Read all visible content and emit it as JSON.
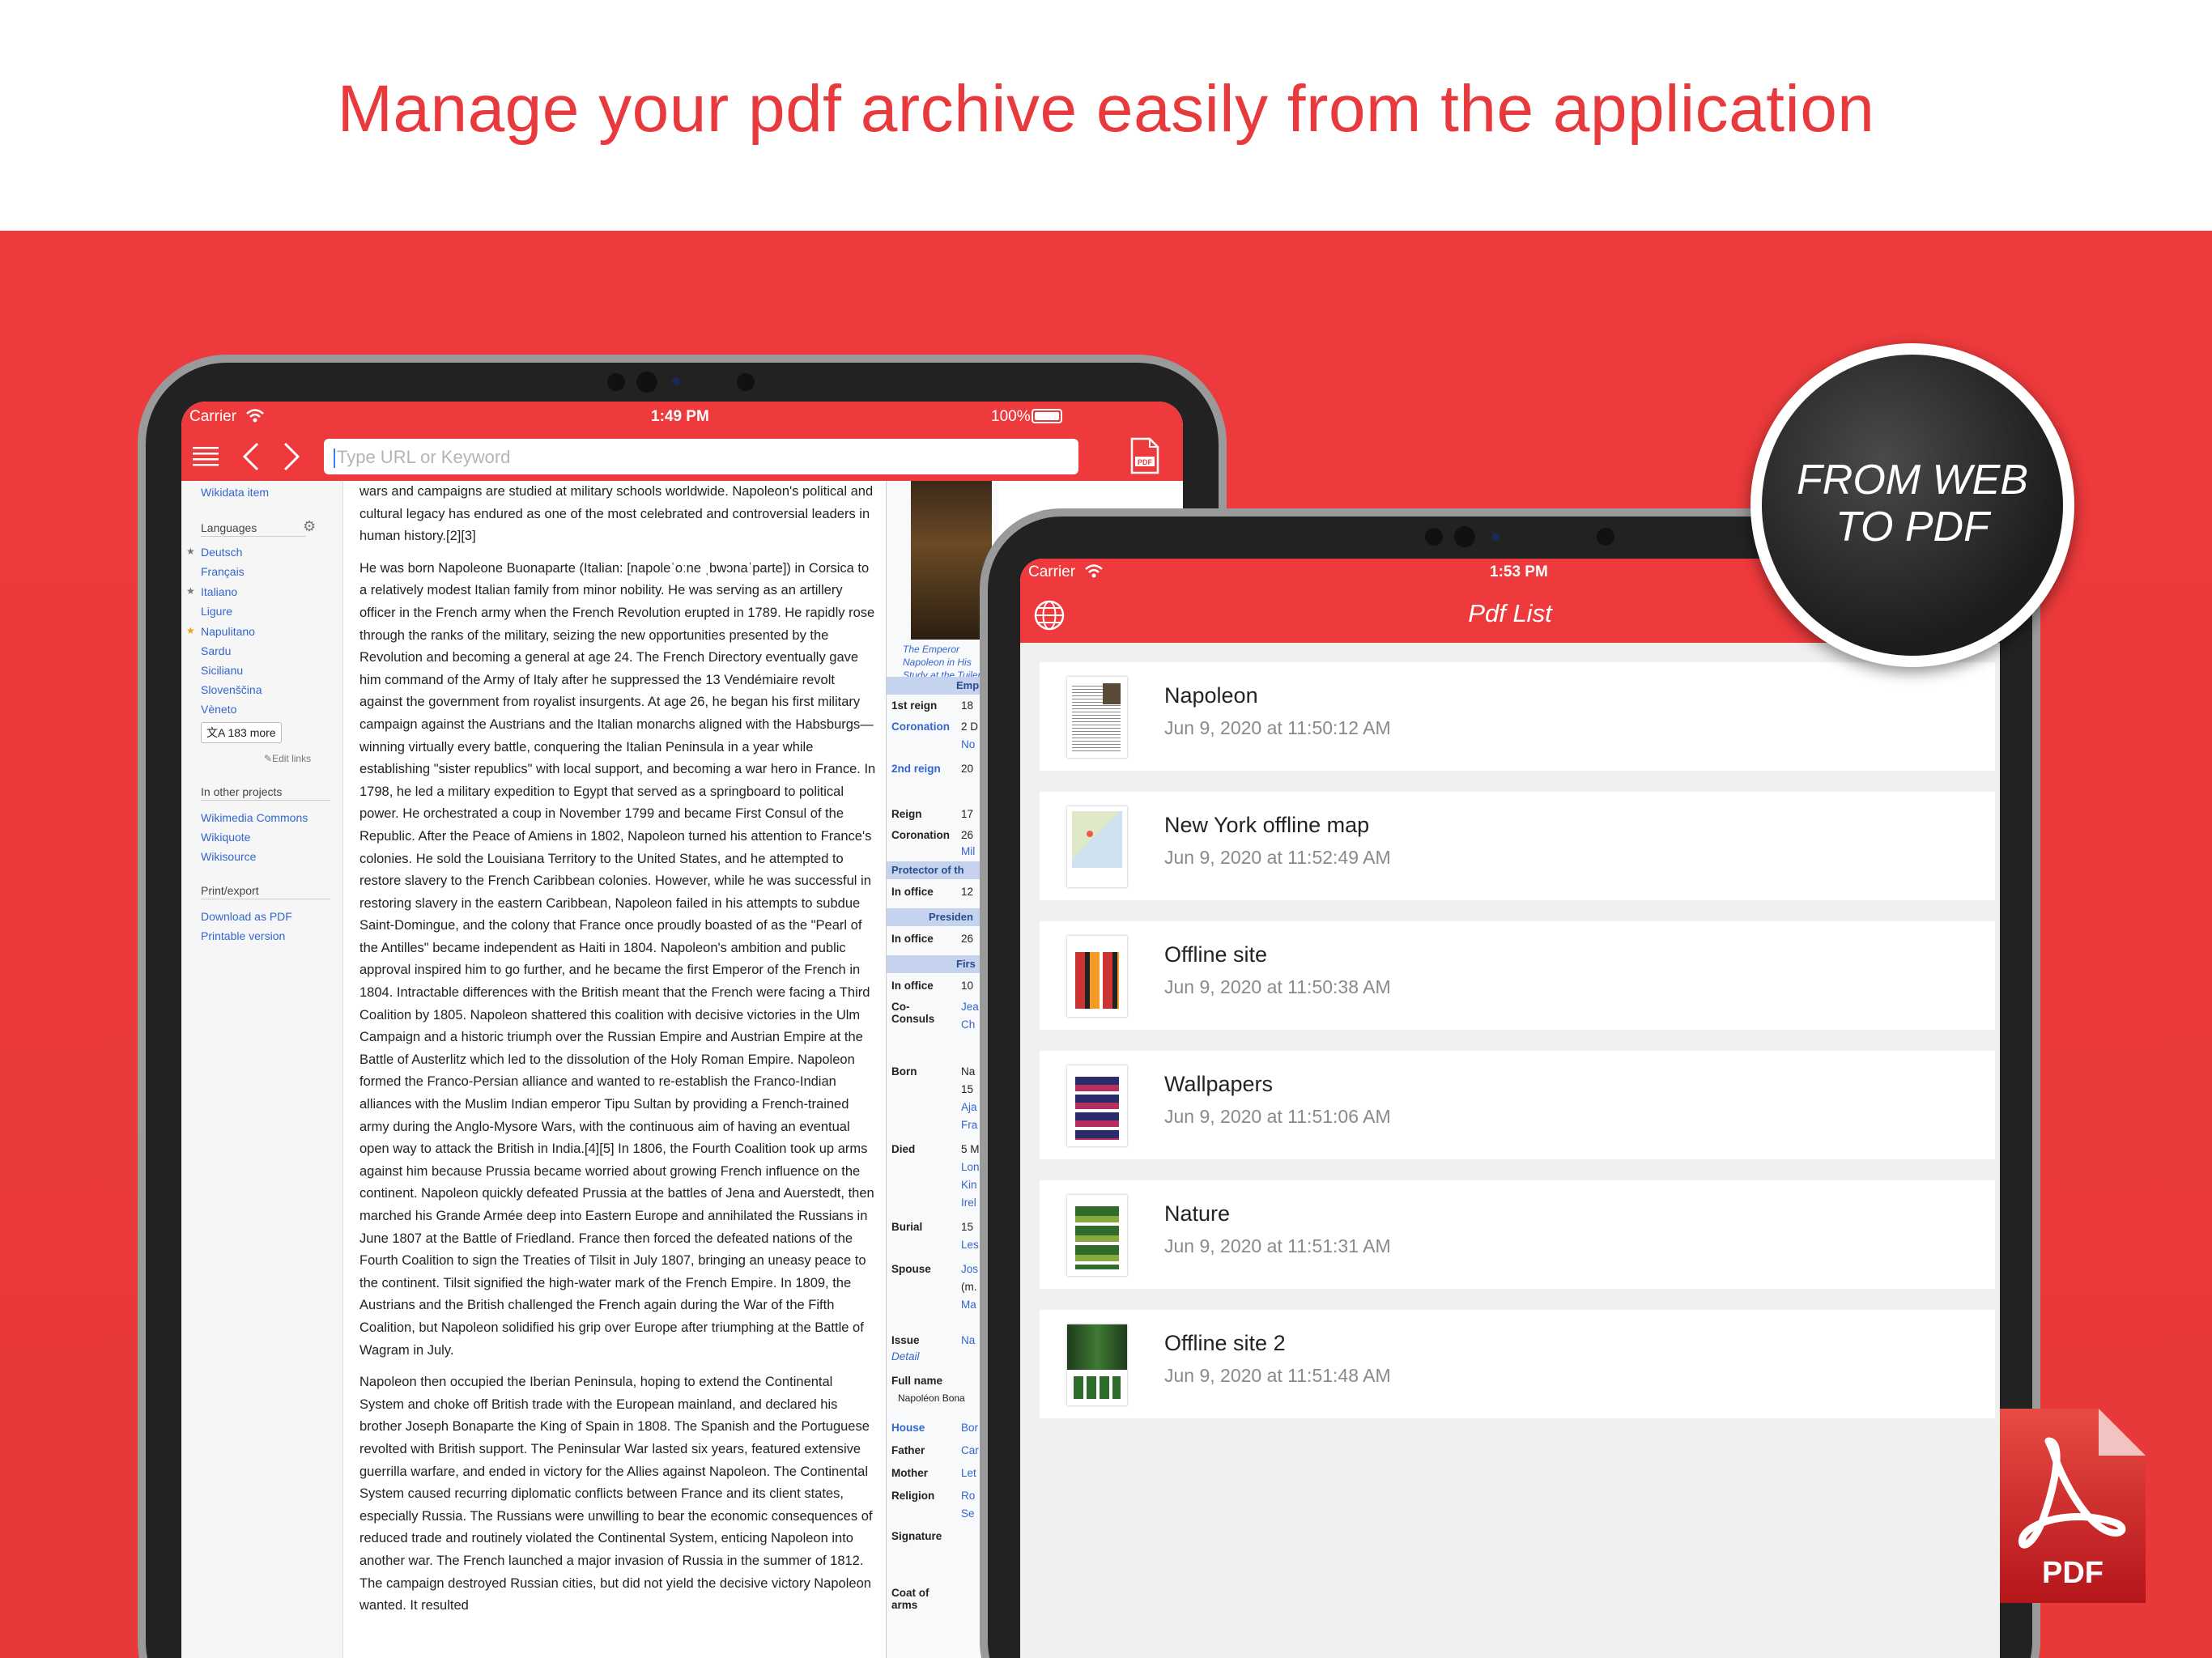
{
  "headline": "Manage your pdf archive easily from the application",
  "colors": {
    "accent": "#ee3a3c",
    "headline": "#e8393d",
    "link": "#3366cc"
  },
  "badge": {
    "line1": "FROM WEB",
    "line2": "TO PDF"
  },
  "pdf_icon_label": "PDF",
  "browser": {
    "carrier": "Carrier",
    "time": "1:49 PM",
    "battery": "100%",
    "url_placeholder": "Type URL or Keyword",
    "icons": [
      "menu-icon",
      "back-arrow-icon",
      "forward-arrow-icon",
      "pdf-export-icon"
    ],
    "sidebar": {
      "wikidata": "Wikidata item",
      "languages_heading": "Languages",
      "languages": [
        "Deutsch",
        "Français",
        "Italiano",
        "Ligure",
        "Napulitano",
        "Sardu",
        "Sicilianu",
        "Slovenščina",
        "Vèneto"
      ],
      "more": "183 more",
      "edit_links": "Edit links",
      "other_projects_heading": "In other projects",
      "other_projects": [
        "Wikimedia Commons",
        "Wikiquote",
        "Wikisource"
      ],
      "print_heading": "Print/export",
      "print_items": [
        "Download as PDF",
        "Printable version"
      ]
    },
    "article": {
      "p0": "wars and campaigns are studied at military schools worldwide. Napoleon's political and cultural legacy has endured as one of the most celebrated and controversial leaders in human history.[2][3]",
      "p1": "He was born Napoleone Buonaparte (Italian: [napoleˈoːne ˌbwɔnaˈparte]) in Corsica to a relatively modest Italian family from minor nobility. He was serving as an artillery officer in the French army when the French Revolution erupted in 1789. He rapidly rose through the ranks of the military, seizing the new opportunities presented by the Revolution and becoming a general at age 24. The French Directory eventually gave him command of the Army of Italy after he suppressed the 13 Vendémiaire revolt against the government from royalist insurgents. At age 26, he began his first military campaign against the Austrians and the Italian monarchs aligned with the Habsburgs—winning virtually every battle, conquering the Italian Peninsula in a year while establishing \"sister republics\" with local support, and becoming a war hero in France. In 1798, he led a military expedition to Egypt that served as a springboard to political power. He orchestrated a coup in November 1799 and became First Consul of the Republic. After the Peace of Amiens in 1802, Napoleon turned his attention to France's colonies. He sold the Louisiana Territory to the United States, and he attempted to restore slavery to the French Caribbean colonies. However, while he was successful in restoring slavery in the eastern Caribbean, Napoleon failed in his attempts to subdue Saint-Domingue, and the colony that France once proudly boasted of as the \"Pearl of the Antilles\" became independent as Haiti in 1804. Napoleon's ambition and public approval inspired him to go further, and he became the first Emperor of the French in 1804. Intractable differences with the British meant that the French were facing a Third Coalition by 1805. Napoleon shattered this coalition with decisive victories in the Ulm Campaign and a historic triumph over the Russian Empire and Austrian Empire at the Battle of Austerlitz which led to the dissolution of the Holy Roman Empire. Napoleon formed the Franco-Persian alliance and wanted to re-establish the Franco-Indian alliances with the Muslim Indian emperor Tipu Sultan by providing a French-trained army during the Anglo-Mysore Wars, with the continuous aim of having an eventual open way to attack the British in India.[4][5] In 1806, the Fourth Coalition took up arms against him because Prussia became worried about growing French influence on the continent. Napoleon quickly defeated Prussia at the battles of Jena and Auerstedt, then marched his Grande Armée deep into Eastern Europe and annihilated the Russians in June 1807 at the Battle of Friedland. France then forced the defeated nations of the Fourth Coalition to sign the Treaties of Tilsit in July 1807, bringing an uneasy peace to the continent. Tilsit signified the high-water mark of the French Empire. In 1809, the Austrians and the British challenged the French again during the War of the Fifth Coalition, but Napoleon solidified his grip over Europe after triumphing at the Battle of Wagram in July.",
      "p2": "Napoleon then occupied the Iberian Peninsula, hoping to extend the Continental System and choke off British trade with the European mainland, and declared his brother Joseph Bonaparte the King of Spain in 1808. The Spanish and the Portuguese revolted with British support. The Peninsular War lasted six years, featured extensive guerrilla warfare, and ended in victory for the Allies against Napoleon. The Continental System caused recurring diplomatic conflicts between France and its client states, especially Russia. The Russians were unwilling to bear the economic consequences of reduced trade and routinely violated the Continental System, enticing Napoleon into another war. The French launched a major invasion of Russia in the summer of 1812. The campaign destroyed Russian cities, but did not yield the decisive victory Napoleon wanted. It resulted"
    },
    "infobox": {
      "caption": "The Emperor Napoleon in His Study at the Tuileries by",
      "headers": [
        "Emp",
        "Protector of th",
        "Presiden",
        "Firs"
      ],
      "labels": [
        "1st reign",
        "Coronation",
        "2nd reign",
        "Reign",
        "Coronation",
        "In office",
        "In office",
        "In office",
        "Co-Consuls",
        "Born",
        "Died",
        "Burial",
        "Spouse",
        "Issue",
        "Full name",
        "House",
        "Father",
        "Mother",
        "Religion",
        "Signature",
        "Coat of arms"
      ],
      "detail": "Detail",
      "full_name_value": "Napoléon Bona",
      "values": [
        "18",
        "2 D",
        "No",
        "20",
        "17",
        "26",
        "Mil",
        "12",
        "26",
        "10",
        "Jea",
        "Ch",
        "Na",
        "15",
        "Aja",
        "Fra",
        "5 M",
        "Lon",
        "Kin",
        "Irel",
        "15",
        "Les",
        "Jos",
        "(m.",
        "Ma",
        "Na",
        "Bor",
        "Car",
        "Let",
        "Ro",
        "Se"
      ]
    }
  },
  "pdf_app": {
    "carrier": "Carrier",
    "time": "1:53 PM",
    "title": "Pdf List",
    "icons": [
      "globe-icon"
    ],
    "items": [
      {
        "name": "Napoleon",
        "date": "Jun 9, 2020 at 11:50:12 AM"
      },
      {
        "name": "New York offline map",
        "date": "Jun 9, 2020 at 11:52:49 AM"
      },
      {
        "name": "Offline site",
        "date": "Jun 9, 2020 at 11:50:38 AM"
      },
      {
        "name": "Wallpapers",
        "date": "Jun 9, 2020 at 11:51:06 AM"
      },
      {
        "name": "Nature",
        "date": "Jun 9, 2020 at 11:51:31 AM"
      },
      {
        "name": "Offline site 2",
        "date": "Jun 9, 2020 at 11:51:48 AM"
      }
    ]
  }
}
